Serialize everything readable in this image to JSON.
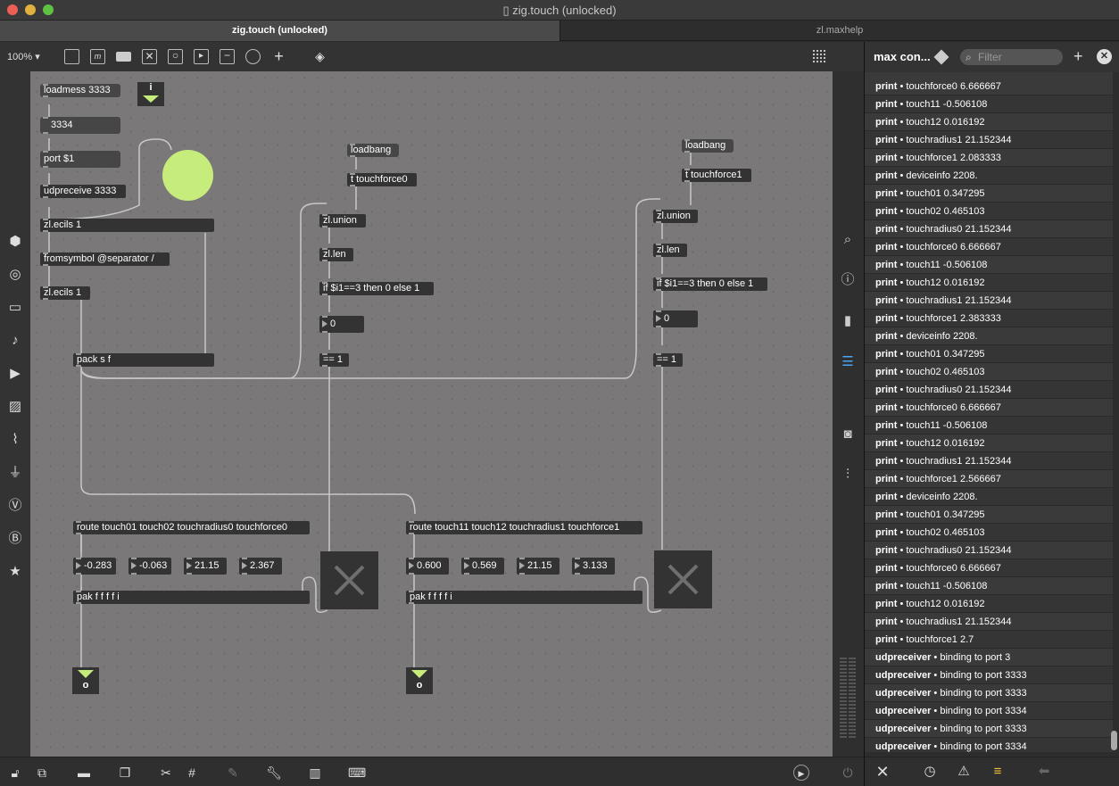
{
  "window": {
    "title": "zig.touch (unlocked)",
    "tabs": [
      {
        "label": "zig.touch (unlocked)",
        "active": true
      },
      {
        "label": "zl.maxhelp",
        "active": false
      }
    ]
  },
  "toolbar": {
    "zoom": "100%",
    "icons": [
      "presentation-icon",
      "message-icon",
      "comment-icon",
      "toggle-icon",
      "button-icon",
      "number-icon",
      "slider-icon",
      "dial-icon",
      "add-icon",
      "paint-icon",
      "grid-icon"
    ]
  },
  "patcher": {
    "objects": {
      "loadmess": "loadmess 3333",
      "num_3334": "3334",
      "port_msg": "port $1",
      "udpreceive": "udpreceive 3333",
      "zl_ecils_1a": "zl.ecils 1",
      "fromsymbol": "fromsymbol @separator /",
      "zl_ecils_1b": "zl.ecils 1",
      "pack_sf": "pack s f",
      "bang_top_label": "i",
      "loadbang_a": "loadbang",
      "t_touchforce0": "t touchforce0",
      "zl_union_a": "zl.union",
      "zl_len_a": "zl.len",
      "if_a": "if $i1==3 then 0 else 1",
      "num_zero_a": "0",
      "eq_a": "== 1",
      "loadbang_b": "loadbang",
      "t_touchforce1": "t touchforce1",
      "zl_union_b": "zl.union",
      "zl_len_b": "zl.len",
      "if_b": "if $i1==3 then 0 else 1",
      "num_zero_b": "0",
      "eq_b": "== 1",
      "route_a": "route touch01 touch02 touchradius0 touchforce0",
      "route_b": "route touch11 touch12 touchradius1 touchforce1",
      "pak_a": "pak f f f f i",
      "pak_b": "pak f f f f i",
      "out_a_label": "o",
      "out_b_label": "o"
    },
    "numbers_a": [
      "-0.283",
      "-0.063",
      "21.15",
      "2.367"
    ],
    "numbers_b": [
      "0.600",
      "0.569",
      "21.15",
      "3.133"
    ],
    "colors": {
      "led": "#c6ec7c",
      "canvas": "#7b7879",
      "wire": "#c8c8c8"
    }
  },
  "console": {
    "title": "max con...",
    "filter_placeholder": "Filter",
    "log": [
      {
        "src": "print",
        "msg": "touchforce0 6.666667"
      },
      {
        "src": "print",
        "msg": "touch11 -0.506108"
      },
      {
        "src": "print",
        "msg": "touch12 0.016192"
      },
      {
        "src": "print",
        "msg": "touchradius1 21.152344"
      },
      {
        "src": "print",
        "msg": "touchforce1 2.083333"
      },
      {
        "src": "print",
        "msg": "deviceinfo 2208."
      },
      {
        "src": "print",
        "msg": "touch01 0.347295"
      },
      {
        "src": "print",
        "msg": "touch02 0.465103"
      },
      {
        "src": "print",
        "msg": "touchradius0 21.152344"
      },
      {
        "src": "print",
        "msg": "touchforce0 6.666667"
      },
      {
        "src": "print",
        "msg": "touch11 -0.506108"
      },
      {
        "src": "print",
        "msg": "touch12 0.016192"
      },
      {
        "src": "print",
        "msg": "touchradius1 21.152344"
      },
      {
        "src": "print",
        "msg": "touchforce1 2.383333"
      },
      {
        "src": "print",
        "msg": "deviceinfo 2208."
      },
      {
        "src": "print",
        "msg": "touch01 0.347295"
      },
      {
        "src": "print",
        "msg": "touch02 0.465103"
      },
      {
        "src": "print",
        "msg": "touchradius0 21.152344"
      },
      {
        "src": "print",
        "msg": "touchforce0 6.666667"
      },
      {
        "src": "print",
        "msg": "touch11 -0.506108"
      },
      {
        "src": "print",
        "msg": "touch12 0.016192"
      },
      {
        "src": "print",
        "msg": "touchradius1 21.152344"
      },
      {
        "src": "print",
        "msg": "touchforce1 2.566667"
      },
      {
        "src": "print",
        "msg": "deviceinfo 2208."
      },
      {
        "src": "print",
        "msg": "touch01 0.347295"
      },
      {
        "src": "print",
        "msg": "touch02 0.465103"
      },
      {
        "src": "print",
        "msg": "touchradius0 21.152344"
      },
      {
        "src": "print",
        "msg": "touchforce0 6.666667"
      },
      {
        "src": "print",
        "msg": "touch11 -0.506108"
      },
      {
        "src": "print",
        "msg": "touch12 0.016192"
      },
      {
        "src": "print",
        "msg": "touchradius1 21.152344"
      },
      {
        "src": "print",
        "msg": "touchforce1 2.7"
      },
      {
        "src": "udpreceiver",
        "msg": "binding to port 3"
      },
      {
        "src": "udpreceiver",
        "msg": "binding to port 3333"
      },
      {
        "src": "udpreceiver",
        "msg": "binding to port 3333"
      },
      {
        "src": "udpreceiver",
        "msg": "binding to port 3334"
      },
      {
        "src": "udpreceiver",
        "msg": "binding to port 3333"
      },
      {
        "src": "udpreceiver",
        "msg": "binding to port 3334"
      }
    ]
  }
}
